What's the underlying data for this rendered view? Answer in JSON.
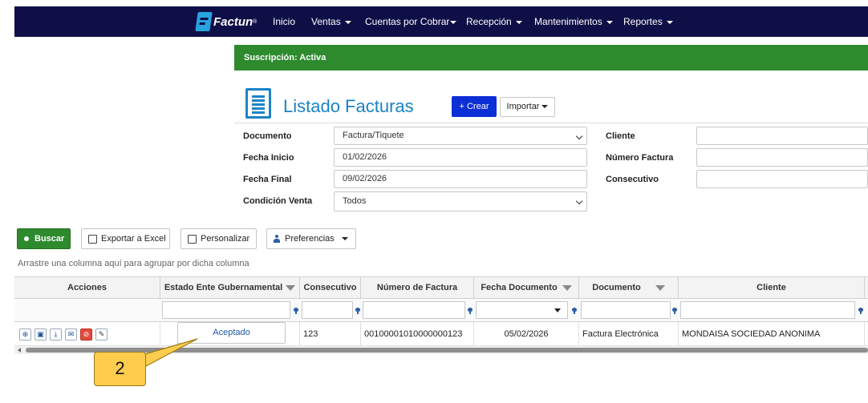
{
  "navbar": {
    "brand": "Factun",
    "brand_mark": "®",
    "items": [
      "Inicio",
      "Ventas",
      "Cuentas por Cobrar",
      "Recepción",
      "Mantenimientos",
      "Reportes"
    ]
  },
  "subscription": "Suscripción: Activa",
  "page": {
    "title": "Listado Facturas",
    "crear": "+ Crear",
    "importar": "Importar"
  },
  "form": {
    "documento_label": "Documento",
    "documento_value": "Factura/Tiquete",
    "fecha_inicio_label": "Fecha Inicio",
    "fecha_inicio_value": "01/02/2026",
    "fecha_final_label": "Fecha Final",
    "fecha_final_value": "09/02/2026",
    "condicion_label": "Condición Venta",
    "condicion_value": "Todos",
    "cliente_label": "Cliente",
    "cliente_value": "",
    "numero_label": "Número Factura",
    "numero_value": "",
    "consecutivo_label": "Consecutivo",
    "consecutivo_value": ""
  },
  "toolbar": {
    "buscar": "Buscar",
    "exportar": "Exportar a Excel",
    "personalizar": "Personalizar",
    "preferencias": "Preferencias"
  },
  "grid": {
    "group_hint": "Arrastre una columna aquí para agrupar por dicha columna",
    "headers": [
      "Acciones",
      "Estado Ente Gubernamental",
      "Consecutivo",
      "Número de Factura",
      "Fecha Documento",
      "Documento",
      "Cliente"
    ],
    "row": {
      "estado": "Aceptado",
      "consecutivo": "123",
      "numero": "00100001010000000123",
      "fecha": "05/02/2026",
      "documento": "Factura Electrónica",
      "cliente": "MONDAISA SOCIEDAD ANONIMA"
    }
  },
  "callout": "2",
  "colors": {
    "navbar": "#0f0f47",
    "accent": "#1a83c6",
    "success": "#2d8a2d",
    "primary_button": "#0d2fd6",
    "callout": "#ffcc4d"
  }
}
